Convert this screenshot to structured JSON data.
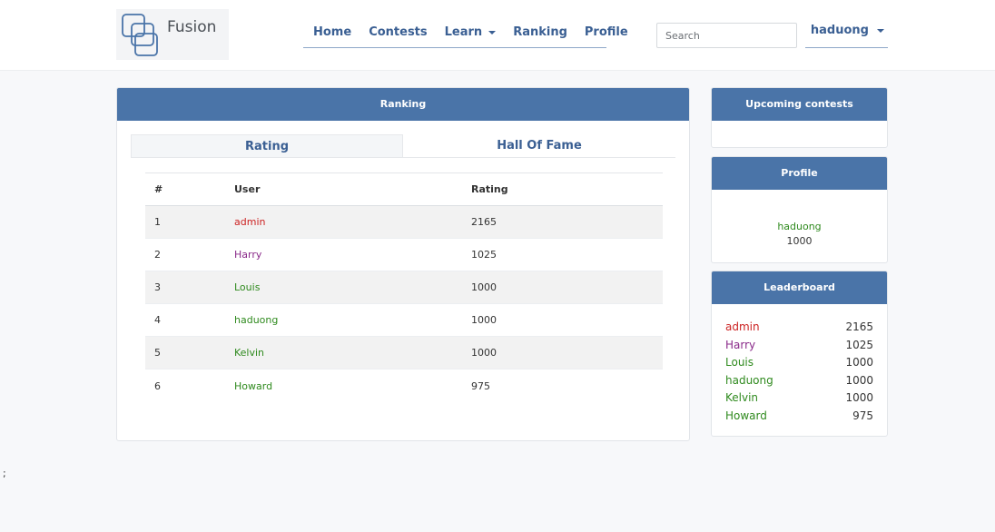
{
  "brand": {
    "name": "Fusion"
  },
  "nav": {
    "items": [
      {
        "label": "Home"
      },
      {
        "label": "Contests"
      },
      {
        "label": "Learn",
        "dropdown": true
      },
      {
        "label": "Ranking"
      },
      {
        "label": "Profile"
      }
    ],
    "search_placeholder": "Search",
    "user": "haduong"
  },
  "ranking": {
    "title": "Ranking",
    "tabs": [
      {
        "label": "Rating",
        "active": true
      },
      {
        "label": "Hall Of Fame",
        "active": false
      }
    ],
    "columns": [
      "#",
      "User",
      "Rating"
    ],
    "rows": [
      {
        "rank": "1",
        "user": "admin",
        "rating": "2165",
        "color": "#cc2222"
      },
      {
        "rank": "2",
        "user": "Harry",
        "rating": "1025",
        "color": "#8a2a8a"
      },
      {
        "rank": "3",
        "user": "Louis",
        "rating": "1000",
        "color": "#2f8a1e"
      },
      {
        "rank": "4",
        "user": "haduong",
        "rating": "1000",
        "color": "#2f8a1e"
      },
      {
        "rank": "5",
        "user": "Kelvin",
        "rating": "1000",
        "color": "#2f8a1e"
      },
      {
        "rank": "6",
        "user": "Howard",
        "rating": "975",
        "color": "#2f8a1e"
      }
    ]
  },
  "upcoming": {
    "title": "Upcoming contests"
  },
  "profile": {
    "title": "Profile",
    "name": "haduong",
    "rating": "1000",
    "color": "#2f8a1e"
  },
  "leaderboard": {
    "title": "Leaderboard",
    "rows": [
      {
        "user": "admin",
        "rating": "2165",
        "color": "#cc2222"
      },
      {
        "user": "Harry",
        "rating": "1025",
        "color": "#8a2a8a"
      },
      {
        "user": "Louis",
        "rating": "1000",
        "color": "#2f8a1e"
      },
      {
        "user": "haduong",
        "rating": "1000",
        "color": "#2f8a1e"
      },
      {
        "user": "Kelvin",
        "rating": "1000",
        "color": "#2f8a1e"
      },
      {
        "user": "Howard",
        "rating": "975",
        "color": "#2f8a1e"
      }
    ]
  },
  "stray_text": ";",
  "colors": {
    "accent": "#4a74a8",
    "link": "#3a5f93"
  }
}
